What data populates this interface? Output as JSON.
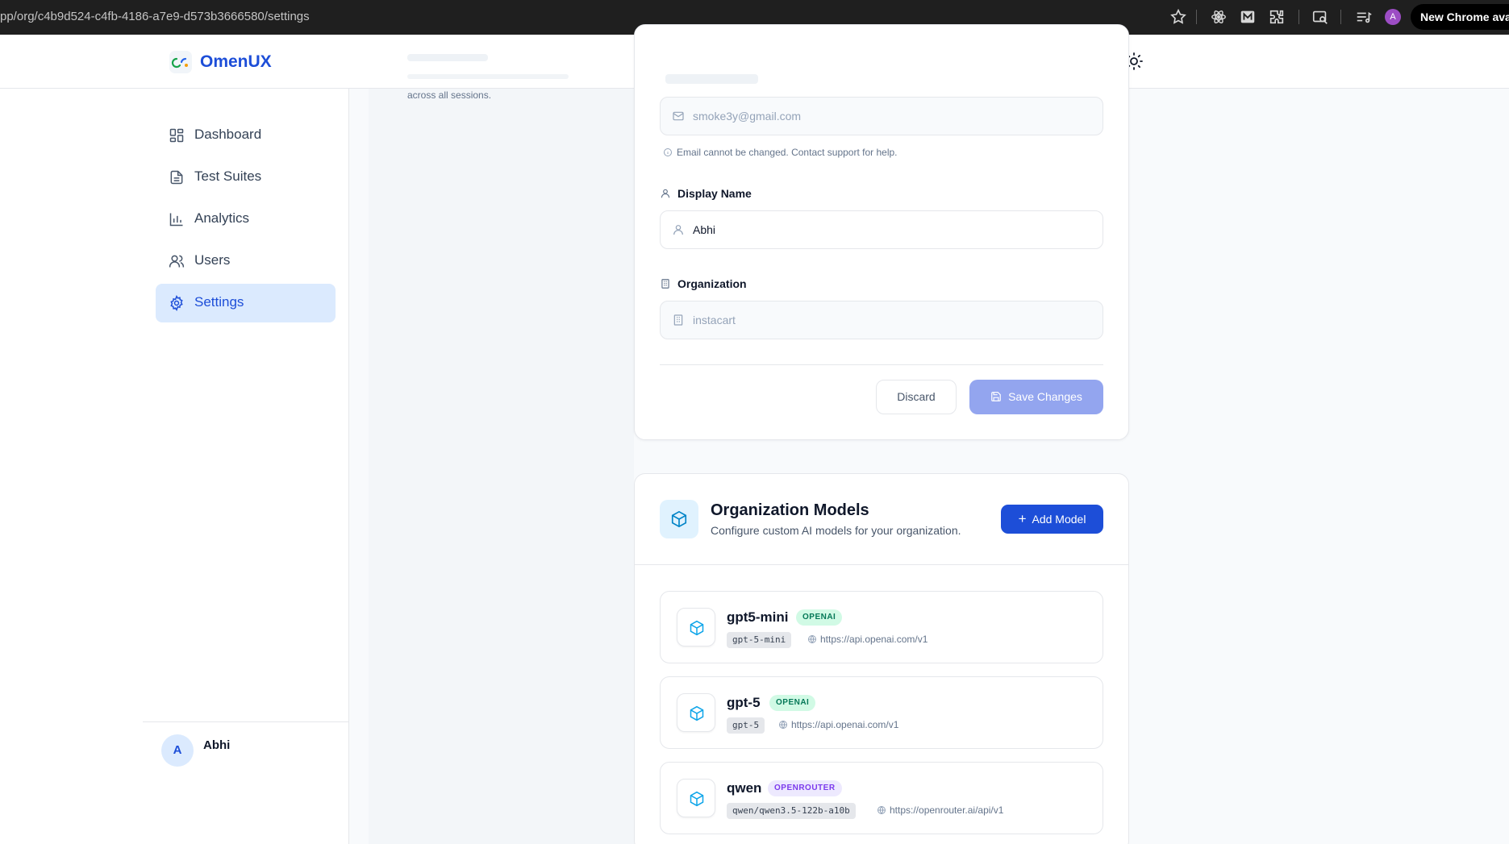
{
  "browser": {
    "url": "pp/org/c4b9d524-c4fb-4186-a7e9-d573b3666580/settings",
    "avatar_initial": "A",
    "notice": "New Chrome available"
  },
  "app": {
    "name": "OmenUX"
  },
  "background_caption": "across all sessions.",
  "sidebar": {
    "items": [
      {
        "label": "Dashboard",
        "icon": "dashboard-icon",
        "active": false
      },
      {
        "label": "Test Suites",
        "icon": "file-icon",
        "active": false
      },
      {
        "label": "Analytics",
        "icon": "bar-chart-icon",
        "active": false
      },
      {
        "label": "Users",
        "icon": "users-icon",
        "active": false
      },
      {
        "label": "Settings",
        "icon": "gear-icon",
        "active": true
      }
    ],
    "user": {
      "initial": "A",
      "name": "Abhi"
    }
  },
  "profile": {
    "email_value": "smoke3y@gmail.com",
    "email_help": "Email cannot be changed. Contact support for help.",
    "display_name_label": "Display Name",
    "display_name_value": "Abhi",
    "organization_label": "Organization",
    "organization_value": "instacart",
    "discard_label": "Discard",
    "save_label": "Save Changes"
  },
  "models": {
    "title": "Organization Models",
    "subtitle": "Configure custom AI models for your organization.",
    "add_label": "Add Model",
    "items": [
      {
        "name": "gpt5-mini",
        "provider": "OPENAI",
        "model_id": "gpt-5-mini",
        "url": "https://api.openai.com/v1"
      },
      {
        "name": "gpt-5",
        "provider": "OPENAI",
        "model_id": "gpt-5",
        "url": "https://api.openai.com/v1"
      },
      {
        "name": "qwen",
        "provider": "OPENROUTER",
        "model_id": "qwen/qwen3.5-122b-a10b",
        "url": "https://openrouter.ai/api/v1"
      }
    ]
  },
  "colors": {
    "brand": "#1d4ed8",
    "active_nav_bg": "#dbeafe",
    "save_disabled": "#93a5ef",
    "openai_badge": "#d1fae5",
    "openrouter_badge": "#ede9fe"
  }
}
